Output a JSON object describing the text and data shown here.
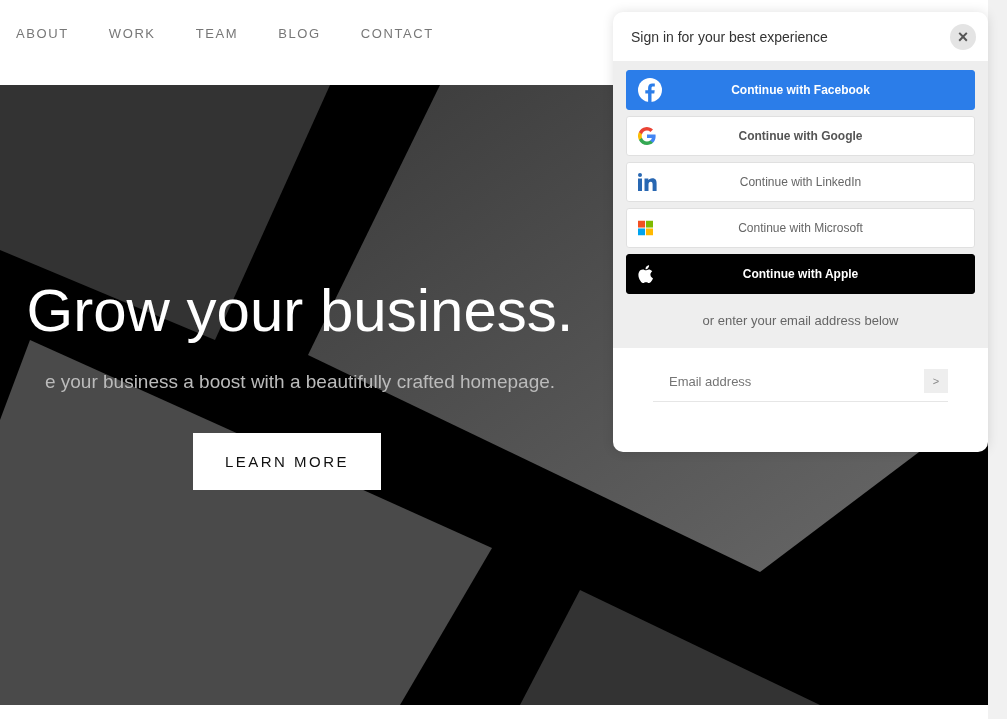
{
  "nav": {
    "items": [
      {
        "label": "ABOUT"
      },
      {
        "label": "WORK"
      },
      {
        "label": "TEAM"
      },
      {
        "label": "BLOG"
      },
      {
        "label": "CONTACT"
      }
    ]
  },
  "hero": {
    "headline": "Grow your business.",
    "subtitle": "e your business a boost with a beautifully crafted homepage.",
    "button": "LEARN MORE"
  },
  "signin": {
    "title": "Sign in for your best experience",
    "close": "×",
    "providers": [
      {
        "kind": "facebook",
        "label": "Continue with Facebook"
      },
      {
        "kind": "google",
        "label": "Continue with Google"
      },
      {
        "kind": "linkedin",
        "label": "Continue with LinkedIn"
      },
      {
        "kind": "microsoft",
        "label": "Continue with Microsoft"
      },
      {
        "kind": "apple",
        "label": "Continue with Apple"
      }
    ],
    "divider": "or enter your email address below",
    "email": {
      "placeholder": "Email address",
      "submit": ">"
    }
  }
}
